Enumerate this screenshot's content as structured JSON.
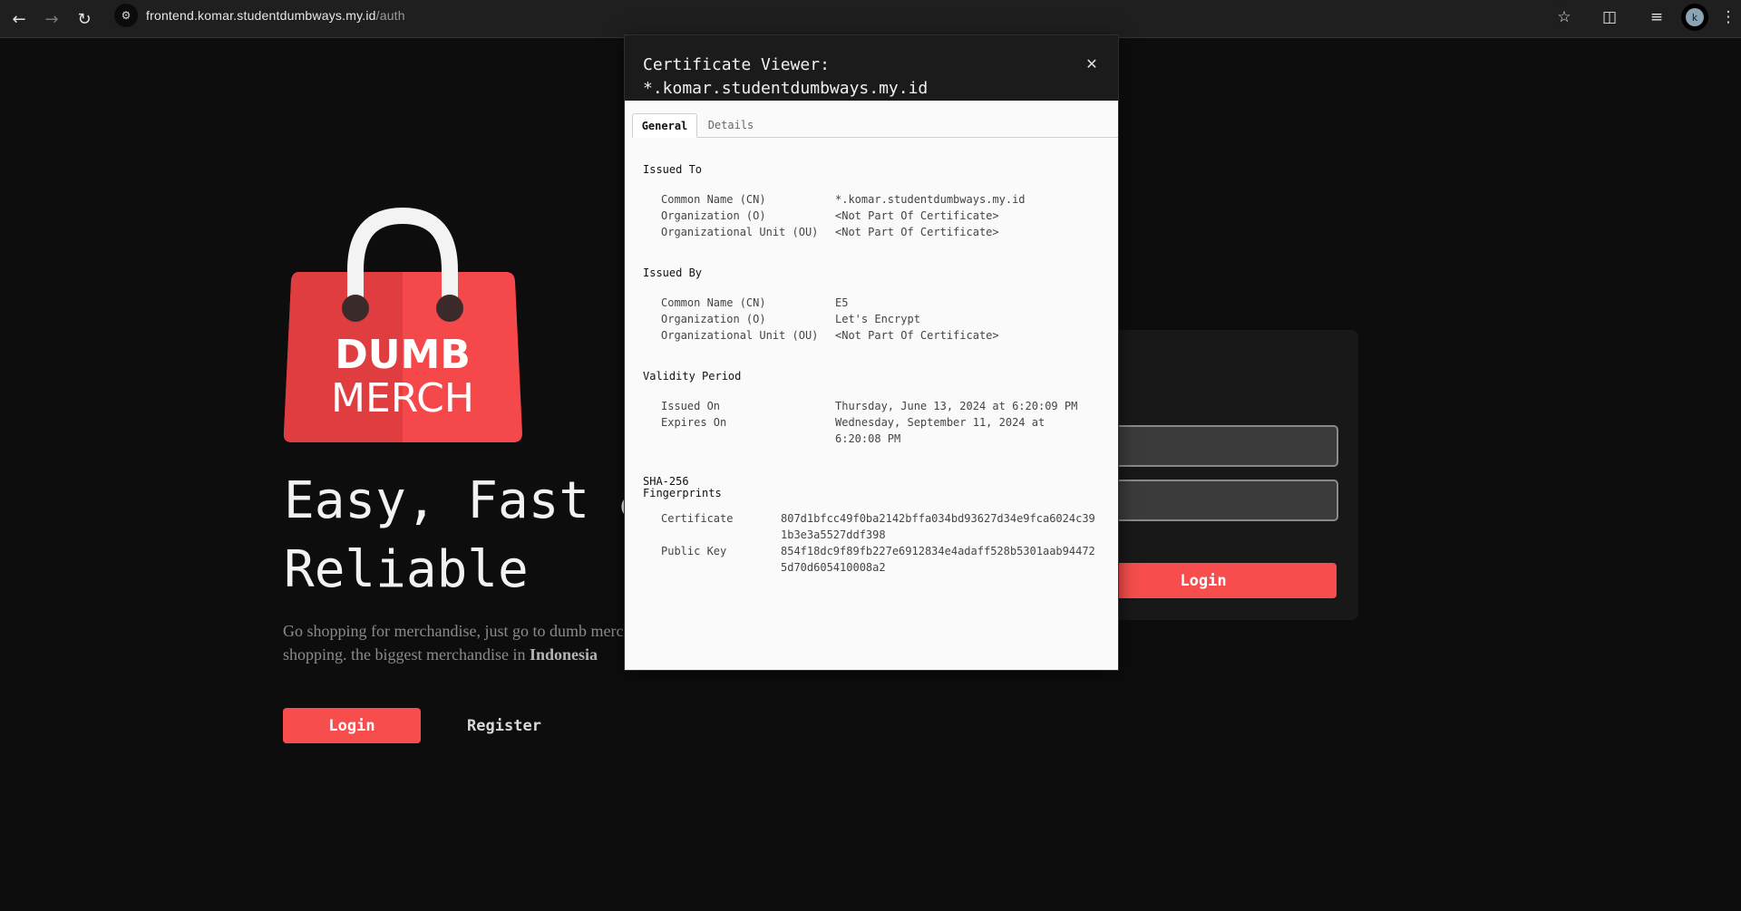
{
  "browser": {
    "url_host": "frontend.komar.studentdumbways.my.id",
    "url_path": "/auth",
    "avatar_letter": "k"
  },
  "page": {
    "logo_text_line1": "DUMB",
    "logo_text_line2": "MERCH",
    "headline_line1": "Easy, Fast &",
    "headline_line2": "Reliable",
    "description_text": "Go shopping for merchandise, just go to dumb merchandise shopping. the biggest merchandise in",
    "description_bold": "Indonesia",
    "login_label": "Login",
    "register_label": "Register",
    "card_login_label": "Login",
    "brand_color": "#f74d4d"
  },
  "certificate": {
    "title_line1": "Certificate Viewer:",
    "title_line2": "*.komar.studentdumbways.my.id",
    "close_glyph": "✕",
    "tabs": [
      "General",
      "Details"
    ],
    "issued_to": {
      "title": "Issued To",
      "rows": [
        {
          "label": "Common Name (CN)",
          "value": "*.komar.studentdumbways.my.id"
        },
        {
          "label": "Organization (O)",
          "value": "<Not Part Of Certificate>"
        },
        {
          "label": "Organizational Unit (OU)",
          "value": "<Not Part Of Certificate>"
        }
      ]
    },
    "issued_by": {
      "title": "Issued By",
      "rows": [
        {
          "label": "Common Name (CN)",
          "value": "E5"
        },
        {
          "label": "Organization (O)",
          "value": "Let's Encrypt"
        },
        {
          "label": "Organizational Unit (OU)",
          "value": "<Not Part Of Certificate>"
        }
      ]
    },
    "validity": {
      "title": "Validity Period",
      "issued_label": "Issued On",
      "issued_value": "Thursday, June 13, 2024 at 6:20:09 PM",
      "expires_label": "Expires On",
      "expires_value": "Wednesday, September 11, 2024 at 6:20:08 PM"
    },
    "fingerprints": {
      "title_line1": "SHA-256",
      "title_line2": "Fingerprints",
      "certificate_label": "Certificate",
      "certificate_value": "807d1bfcc49f0ba2142bffa034bd93627d34e9fca6024c391b3e3a5527ddf398",
      "public_key_label": "Public Key",
      "public_key_value": "854f18dc9f89fb227e6912834e4adaff528b5301aab944725d70d605410008a2"
    }
  }
}
